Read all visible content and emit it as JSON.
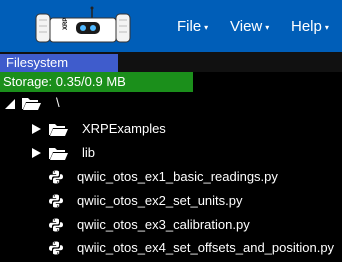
{
  "header": {
    "logo_label": "XRP",
    "menus": [
      {
        "label": "File",
        "caret": "▾"
      },
      {
        "label": "View",
        "caret": "▾"
      },
      {
        "label": "Help",
        "caret": "▾"
      }
    ]
  },
  "tabs": {
    "filesystem": "Filesystem"
  },
  "storage": {
    "label": "Storage: 0.35/0.9 MB",
    "used_fraction": 0.389
  },
  "tree": {
    "root": "\\",
    "folders": [
      "XRPExamples",
      "lib"
    ],
    "files": [
      "qwiic_otos_ex1_basic_readings.py",
      "qwiic_otos_ex2_set_units.py",
      "qwiic_otos_ex3_calibration.py",
      "qwiic_otos_ex4_set_offsets_and_position.py"
    ]
  },
  "colors": {
    "header_bg": "#005eb8",
    "tab_bg": "#3f5ccc",
    "storage_bar": "#1b8f1b",
    "background": "#000000"
  }
}
